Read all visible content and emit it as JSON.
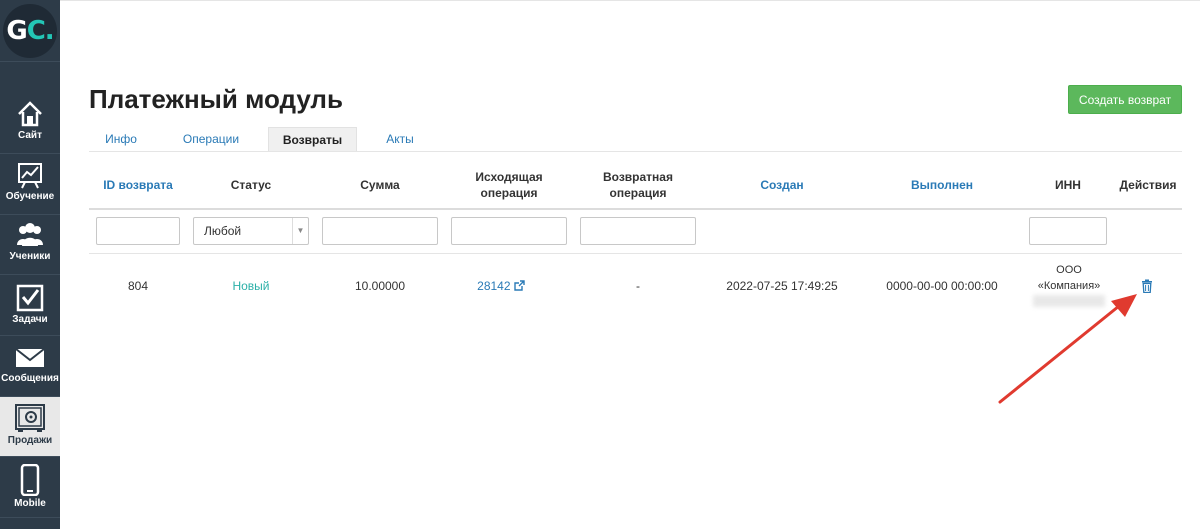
{
  "logo": {
    "text_main": "G",
    "text_accent": "C."
  },
  "sidebar": {
    "items": [
      {
        "label": "Сайт",
        "icon": "home-icon"
      },
      {
        "label": "Обучение",
        "icon": "chart-board-icon"
      },
      {
        "label": "Ученики",
        "icon": "users-icon"
      },
      {
        "label": "Задачи",
        "icon": "checkbox-icon"
      },
      {
        "label": "Сообщения",
        "icon": "envelope-icon"
      },
      {
        "label": "Продажи",
        "icon": "safe-icon"
      },
      {
        "label": "Mobile",
        "icon": "phone-icon"
      }
    ],
    "active_index": 5
  },
  "page": {
    "title": "Платежный модуль",
    "create_button": "Создать возврат"
  },
  "tabs": [
    {
      "label": "Инфо"
    },
    {
      "label": "Операции"
    },
    {
      "label": "Возвраты",
      "active": true
    },
    {
      "label": "Акты"
    }
  ],
  "table": {
    "headers": {
      "id": "ID возврата",
      "status": "Статус",
      "sum": "Сумма",
      "source_op_1": "Исходящая",
      "source_op_2": "операция",
      "return_op_1": "Возвратная",
      "return_op_2": "операция",
      "created": "Создан",
      "done": "Выполнен",
      "inn": "ИНН",
      "actions": "Действия"
    },
    "filters": {
      "status_value": "Любой"
    },
    "rows": [
      {
        "id": "804",
        "status": "Новый",
        "sum": "10.00000",
        "source_op": "28142",
        "return_op": "-",
        "created": "2022-07-25 17:49:25",
        "done": "0000-00-00 00:00:00",
        "inn_line1": "ООО",
        "inn_line2": "«Компания»"
      }
    ]
  },
  "colors": {
    "sidebar_bg": "#2d3b48",
    "accent_teal": "#23c6b6",
    "link_blue": "#2a7ab6",
    "create_green": "#5cb85c",
    "annotation_red": "#e03a2f"
  }
}
